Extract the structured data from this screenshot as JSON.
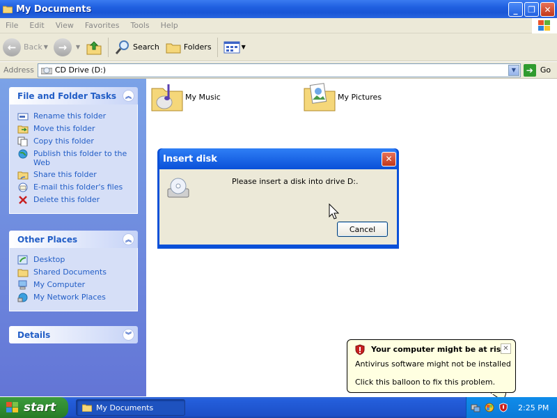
{
  "window": {
    "title": "My Documents"
  },
  "menu": [
    "File",
    "Edit",
    "View",
    "Favorites",
    "Tools",
    "Help"
  ],
  "toolbar": {
    "back": "Back",
    "search": "Search",
    "folders": "Folders"
  },
  "address": {
    "label": "Address",
    "value": "CD Drive (D:)",
    "go": "Go"
  },
  "sidebar": {
    "file_tasks": {
      "header": "File and Folder Tasks",
      "items": [
        "Rename this folder",
        "Move this folder",
        "Copy this folder",
        "Publish this folder to the Web",
        "Share this folder",
        "E-mail this folder's files",
        "Delete this folder"
      ]
    },
    "other_places": {
      "header": "Other Places",
      "items": [
        "Desktop",
        "Shared Documents",
        "My Computer",
        "My Network Places"
      ]
    },
    "details": {
      "header": "Details"
    }
  },
  "content": {
    "folders": [
      "My Music",
      "My Pictures"
    ]
  },
  "dialog": {
    "title": "Insert disk",
    "message": "Please insert a disk into drive D:.",
    "cancel": "Cancel"
  },
  "balloon": {
    "title": "Your computer might be at risk",
    "line1": "Antivirus software might not be installed",
    "line2": "Click this balloon to fix this problem."
  },
  "taskbar": {
    "start": "start",
    "app": "My Documents",
    "time": "2:25 PM"
  }
}
